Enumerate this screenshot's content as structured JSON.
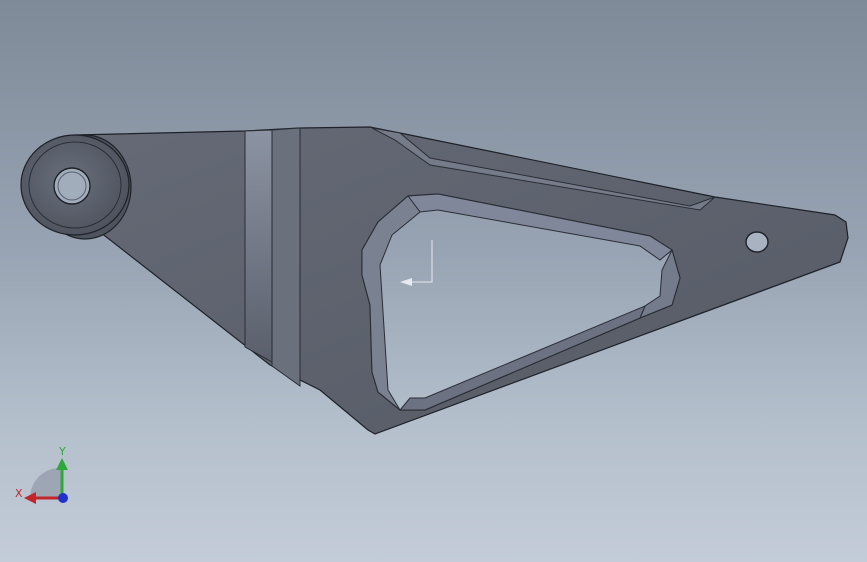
{
  "viewport": {
    "background_top": "#7f8a99",
    "background_bottom": "#c3ccd8",
    "part_color": "#5c616c",
    "edge_color": "#1e2128"
  },
  "triad": {
    "x_label": "X",
    "y_label": "Y",
    "x_color": "#c0262a",
    "y_color": "#2fa83a",
    "z_color": "#2030c8"
  }
}
